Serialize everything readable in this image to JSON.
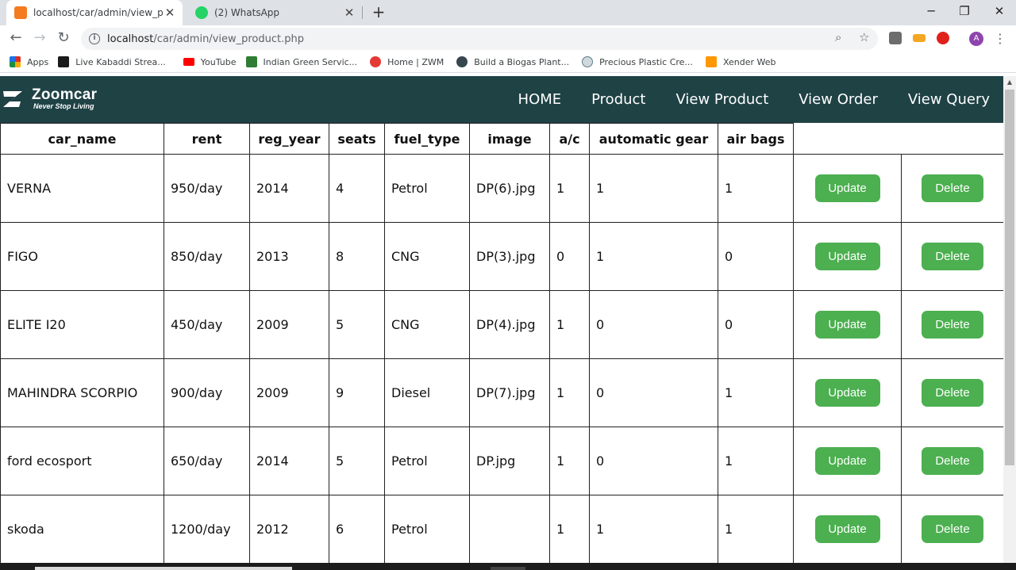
{
  "browser": {
    "tabs": [
      {
        "title": "localhost/car/admin/view_product",
        "icon": "xampp-icon",
        "active": true
      },
      {
        "title": "(2) WhatsApp",
        "icon": "whatsapp-icon",
        "active": false
      }
    ],
    "new_tab": "+",
    "window_controls": {
      "minimize": "─",
      "restore": "❐",
      "close": "✕"
    },
    "url": {
      "host": "localhost",
      "path": "/car/admin/view_product.php"
    },
    "avatar_letter": "A",
    "bookmarks": [
      {
        "label": "Apps",
        "icon": "apps-grid-icon",
        "color": "#d93025"
      },
      {
        "label": "Live Kabaddi Strea...",
        "icon": "kabaddi-icon",
        "color": "#1a1a1a"
      },
      {
        "label": "YouTube",
        "icon": "youtube-icon",
        "color": "#ff0000"
      },
      {
        "label": "Indian Green Servic...",
        "icon": "igs-icon",
        "color": "#2e7d32"
      },
      {
        "label": "Home | ZWM",
        "icon": "zwm-icon",
        "color": "#e53935"
      },
      {
        "label": "Build a Biogas Plant...",
        "icon": "biogas-icon",
        "color": "#37474f"
      },
      {
        "label": "Precious Plastic Cre...",
        "icon": "plastic-icon",
        "color": "#607d8b"
      },
      {
        "label": "Xender Web",
        "icon": "xender-icon",
        "color": "#ff9800"
      }
    ]
  },
  "site": {
    "brand": "Zoomcar",
    "tagline": "Never Stop Living",
    "header_color": "#1f4245",
    "nav": [
      "HOME",
      "Product",
      "View Product",
      "View Order",
      "View Query"
    ]
  },
  "table": {
    "headers": [
      "car_name",
      "rent",
      "reg_year",
      "seats",
      "fuel_type",
      "image",
      "a/c",
      "automatic gear",
      "air bags"
    ],
    "rows": [
      [
        "VERNA",
        "950/day",
        "2014",
        "4",
        "Petrol",
        "DP(6).jpg",
        "1",
        "1",
        "1"
      ],
      [
        "FIGO",
        "850/day",
        "2013",
        "8",
        "CNG",
        "DP(3).jpg",
        "0",
        "1",
        "0"
      ],
      [
        "ELITE I20",
        "450/day",
        "2009",
        "5",
        "CNG",
        "DP(4).jpg",
        "1",
        "0",
        "0"
      ],
      [
        "MAHINDRA SCORPIO",
        "900/day",
        "2009",
        "9",
        "Diesel",
        "DP(7).jpg",
        "1",
        "0",
        "1"
      ],
      [
        "ford ecosport",
        "650/day",
        "2014",
        "5",
        "Petrol",
        "DP.jpg",
        "1",
        "0",
        "1"
      ],
      [
        "skoda",
        "1200/day",
        "2012",
        "6",
        "Petrol",
        "",
        "1",
        "1",
        "1"
      ]
    ],
    "update_label": "Update",
    "delete_label": "Delete",
    "button_color": "#4caf50"
  }
}
